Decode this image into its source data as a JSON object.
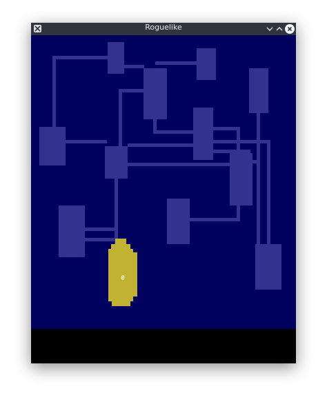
{
  "window": {
    "title": "Roguelike",
    "icons": {
      "app": "x-app-icon",
      "minimize": "chevron-down-icon",
      "maximize": "chevron-up-icon",
      "close": "close-icon"
    }
  },
  "game": {
    "player_glyph": "@",
    "colors": {
      "background": "#00005f",
      "explored": "#33338f",
      "lit": "#c2b233",
      "status_bar": "#000000",
      "titlebar": "#2f343f"
    },
    "status_text": ""
  }
}
